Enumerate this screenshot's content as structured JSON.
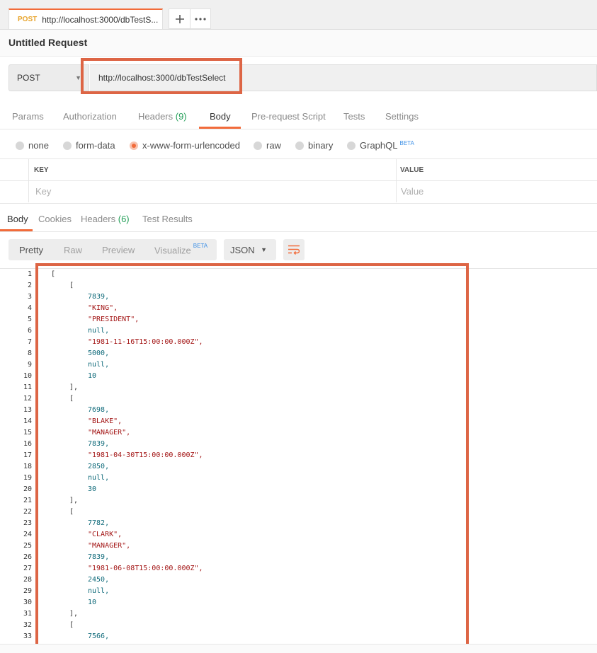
{
  "tab": {
    "method": "POST",
    "label": "http://localhost:3000/dbTestS..."
  },
  "title": "Untitled Request",
  "request": {
    "method": "POST",
    "url": "http://localhost:3000/dbTestSelect"
  },
  "request_tabs": [
    {
      "label": "Params"
    },
    {
      "label": "Authorization"
    },
    {
      "label": "Headers ",
      "count": "(9)"
    },
    {
      "label": "Body"
    },
    {
      "label": "Pre-request Script"
    },
    {
      "label": "Tests"
    },
    {
      "label": "Settings"
    }
  ],
  "body_types": [
    "none",
    "form-data",
    "x-www-form-urlencoded",
    "raw",
    "binary",
    "GraphQL"
  ],
  "beta_badge": "BETA",
  "kv_table": {
    "key_header": "KEY",
    "value_header": "VALUE",
    "key_placeholder": "Key",
    "value_placeholder": "Value"
  },
  "response_tabs": [
    {
      "label": "Body"
    },
    {
      "label": "Cookies"
    },
    {
      "label": "Headers ",
      "count": "(6)"
    },
    {
      "label": "Test Results"
    }
  ],
  "view_modes": [
    "Pretty",
    "Raw",
    "Preview",
    "Visualize"
  ],
  "format": "JSON",
  "code_lines": [
    "[",
    "[",
    "7839,",
    "\"KING\",",
    "\"PRESIDENT\",",
    "null,",
    "\"1981-11-16T15:00:00.000Z\",",
    "5000,",
    "null,",
    "10",
    "],",
    "[",
    "7698,",
    "\"BLAKE\",",
    "\"MANAGER\",",
    "7839,",
    "\"1981-04-30T15:00:00.000Z\",",
    "2850,",
    "null,",
    "30",
    "],",
    "[",
    "7782,",
    "\"CLARK\",",
    "\"MANAGER\",",
    "7839,",
    "\"1981-06-08T15:00:00.000Z\",",
    "2450,",
    "null,",
    "10",
    "],",
    "[",
    "7566,"
  ],
  "icons": {
    "new_tab": "plus-icon",
    "more": "more-horizontal-icon",
    "wrap": "wrap-lines-icon",
    "dropdown": "chevron-down-icon"
  },
  "colors": {
    "accent": "#f26b3a",
    "annotation": "#dd6545",
    "method_post": "#e8a42c",
    "count_green": "#26a05a",
    "beta_blue": "#3a8ee6",
    "string": "#a31515",
    "number": "#0f6a7a"
  }
}
